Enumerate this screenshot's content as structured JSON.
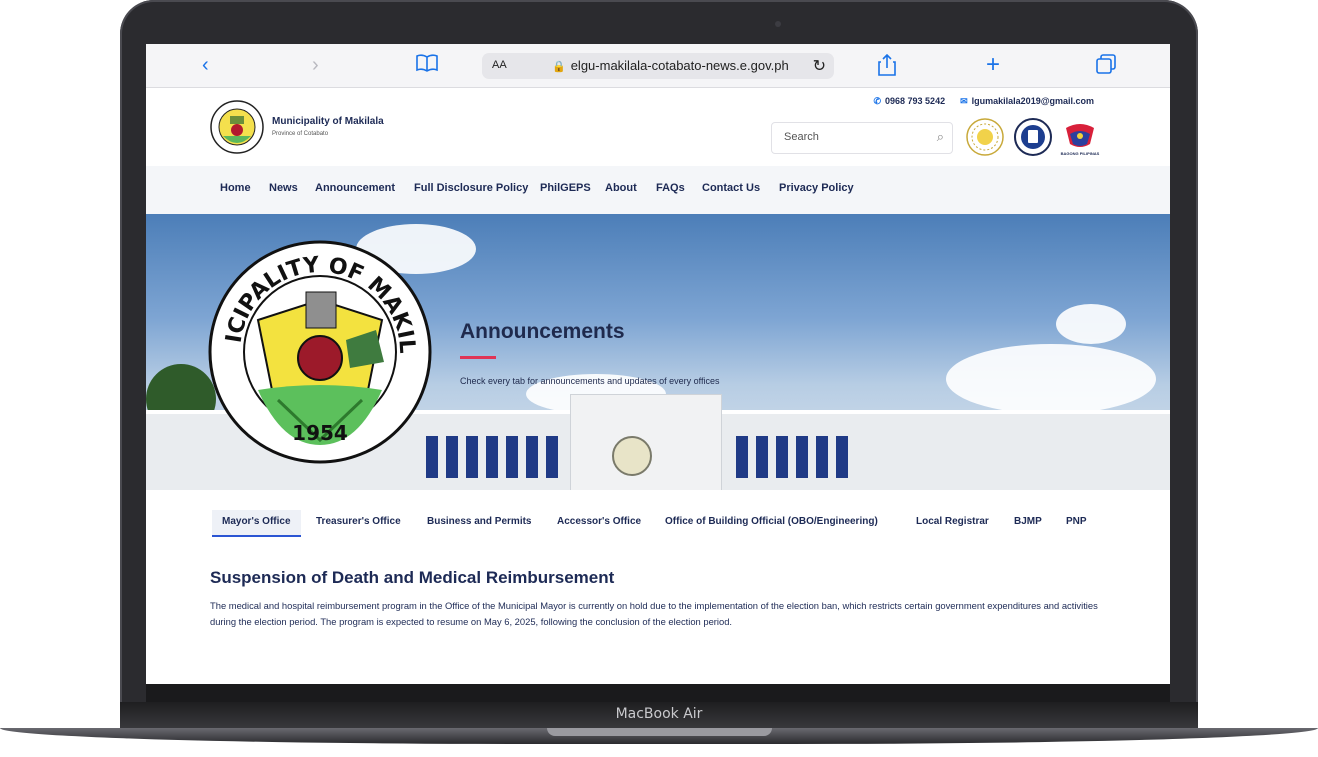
{
  "device": {
    "label": "MacBook Air"
  },
  "browser": {
    "aa_label": "AA",
    "url": "elgu-makilala-cotabato-news.e.gov.ph",
    "icons": {
      "back": "chevron-left-icon",
      "forward": "chevron-right-icon",
      "reader": "book-icon",
      "lock": "lock-icon",
      "reload": "reload-icon",
      "share": "share-icon",
      "new_tab": "plus-icon",
      "tabs": "tabs-icon"
    }
  },
  "site": {
    "name": "Municipality of Makilala",
    "province": "Province of Cotabato",
    "phone": "0968 793 5242",
    "email": "lgumakilala2019@gmail.com",
    "search": {
      "placeholder": "Search"
    },
    "seal_caption": "BAGONG PILIPINAS",
    "logo_text": {
      "top": "MUNICIPALITY OF MAKILALA",
      "year": "1954"
    }
  },
  "nav": {
    "items": [
      {
        "label": "Home"
      },
      {
        "label": "News"
      },
      {
        "label": "Announcement"
      },
      {
        "label": "Full Disclosure Policy"
      },
      {
        "label": "PhilGEPS"
      },
      {
        "label": "About"
      },
      {
        "label": "FAQs"
      },
      {
        "label": "Contact Us"
      },
      {
        "label": "Privacy Policy"
      }
    ]
  },
  "hero": {
    "title": "Announcements",
    "subtitle": "Check every tab for announcements and updates of every offices"
  },
  "tabs": {
    "items": [
      {
        "label": "Mayor's Office",
        "active": true
      },
      {
        "label": "Treasurer's Office"
      },
      {
        "label": "Business and Permits"
      },
      {
        "label": "Accessor's Office"
      },
      {
        "label": "Office of Building Official (OBO/Engineering)"
      },
      {
        "label": "Local Registrar"
      },
      {
        "label": "BJMP"
      },
      {
        "label": "PNP"
      }
    ]
  },
  "article": {
    "title": "Suspension of Death and Medical Reimbursement",
    "body": "The medical and hospital reimbursement program in the Office of the Municipal Mayor is currently on hold due to the implementation of the election ban, which restricts certain government expenditures and activities during the election period. The program is expected to resume on May 6, 2025, following the conclusion of the election period."
  },
  "colors": {
    "brand_navy": "#1d2a55",
    "accent_red": "#e03455",
    "link_blue": "#1a73e8",
    "active_tab_underline": "#2b55d3"
  }
}
